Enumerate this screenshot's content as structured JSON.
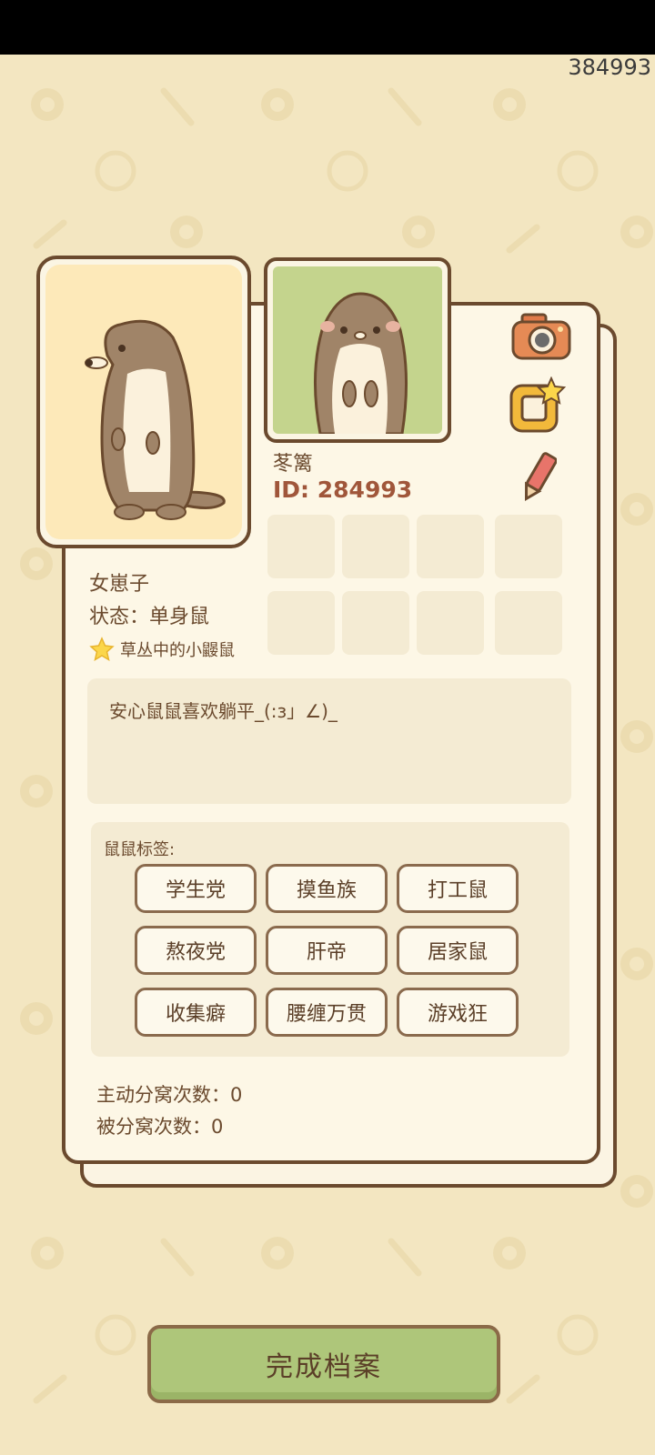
{
  "corner_id": "384993",
  "profile": {
    "name": "苳篱",
    "id_text": "ID: 284993",
    "gender": "女崽子",
    "status": "状态：单身鼠",
    "rank": "草丛中的小鼹鼠",
    "bio": "安心鼠鼠喜欢躺平_(:з」∠)_"
  },
  "tags": {
    "title": "鼠鼠标签:",
    "items": [
      "学生党",
      "摸鱼族",
      "打工鼠",
      "熬夜党",
      "肝帝",
      "居家鼠",
      "收集癖",
      "腰缠万贯",
      "游戏狂"
    ]
  },
  "stats": {
    "active_split": "主动分窝次数：0",
    "passive_split": "被分窝次数：0"
  },
  "button": {
    "done_label": "完成档案"
  },
  "icons": {
    "camera": "camera-icon",
    "badge": "star-frame-icon",
    "edit": "pencil-icon",
    "rank_star": "star-icon"
  },
  "colors": {
    "background": "#f3e6c1",
    "card": "#fdf7e6",
    "border": "#6b4a2e",
    "id_text": "#a0563a",
    "button": "#aec67a"
  }
}
